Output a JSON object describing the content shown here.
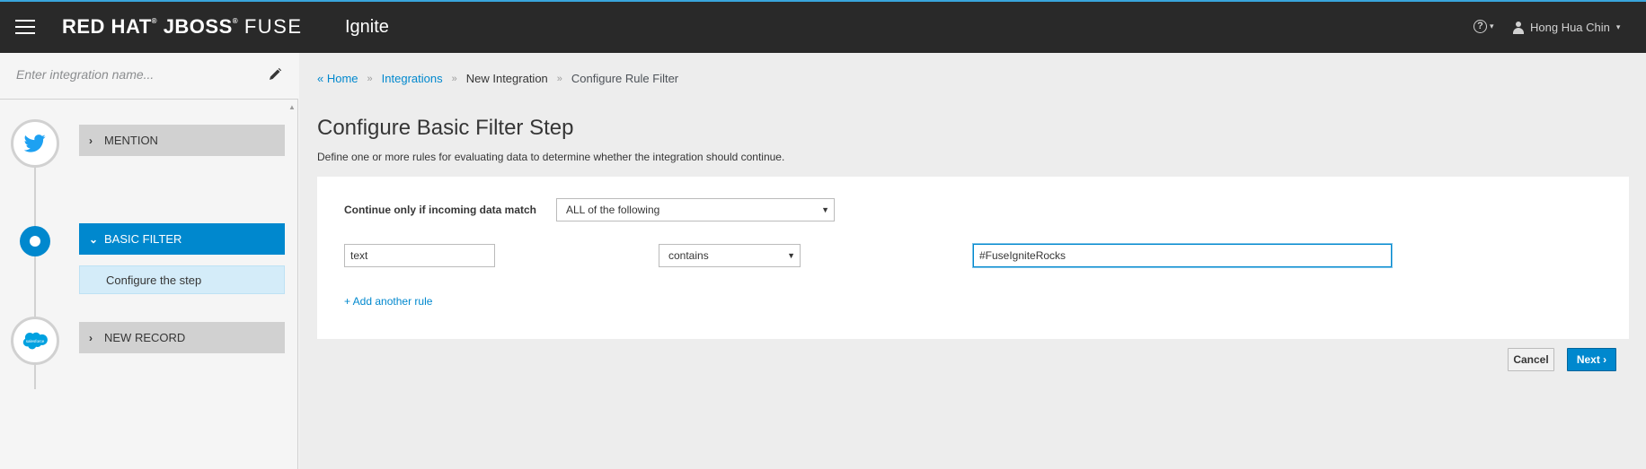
{
  "header": {
    "brand_red_hat": "RED HAT",
    "brand_jboss": "JBOSS",
    "brand_fuse": "FUSE",
    "product": "Ignite",
    "user_name": "Hong Hua Chin"
  },
  "sidebar": {
    "name_placeholder": "Enter integration name...",
    "steps": [
      {
        "label": "MENTION",
        "icon": "twitter-icon"
      },
      {
        "label": "BASIC FILTER",
        "icon": "filter-step-dot"
      },
      {
        "label": "NEW RECORD",
        "icon": "salesforce-icon"
      }
    ],
    "substep_label": "Configure the step"
  },
  "breadcrumb": {
    "home": "Home",
    "integrations": "Integrations",
    "new_integration": "New Integration",
    "current": "Configure Rule Filter"
  },
  "main": {
    "title": "Configure Basic Filter Step",
    "description": "Define one or more rules for evaluating data to determine whether the integration should continue.",
    "match_label": "Continue only if incoming data match",
    "match_value": "ALL of the following",
    "rule": {
      "field": "text",
      "operator": "contains",
      "value": "#FuseIgniteRocks"
    },
    "add_rule": "+ Add another rule",
    "cancel_label": "Cancel",
    "next_label": "Next"
  },
  "colors": {
    "topbar": "#292929",
    "accent": "#0088ce",
    "substep_bg": "#d4ecf9",
    "twitter": "#1da1f2",
    "salesforce": "#00a1e0"
  }
}
